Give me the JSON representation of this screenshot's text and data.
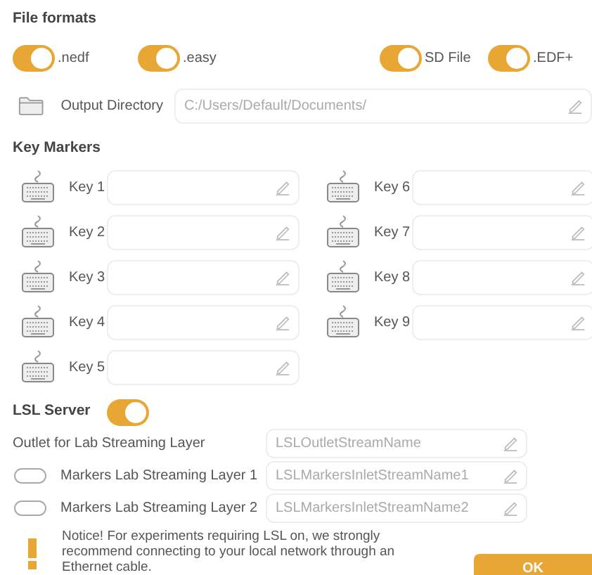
{
  "file_formats": {
    "title": "File formats",
    "toggles": [
      {
        "label": ".nedf",
        "on": true
      },
      {
        "label": ".easy",
        "on": true
      },
      {
        "label": "SD File",
        "on": true
      },
      {
        "label": ".EDF+",
        "on": true
      }
    ]
  },
  "output_directory": {
    "label": "Output Directory",
    "placeholder": "C:/Users/Default/Documents/"
  },
  "key_markers": {
    "title": "Key Markers",
    "keys": [
      {
        "label": "Key 1"
      },
      {
        "label": "Key 2"
      },
      {
        "label": "Key 3"
      },
      {
        "label": "Key 4"
      },
      {
        "label": "Key 5"
      },
      {
        "label": "Key 6"
      },
      {
        "label": "Key 7"
      },
      {
        "label": "Key 8"
      },
      {
        "label": "Key 9"
      }
    ]
  },
  "lsl_server": {
    "title": "LSL Server",
    "on": true,
    "streams": [
      {
        "kind": "plain",
        "label": "Outlet for Lab Streaming Layer",
        "placeholder": "LSLOutletStreamName"
      },
      {
        "kind": "toggle",
        "on": false,
        "label": "Markers Lab Streaming Layer 1",
        "placeholder": "LSLMarkersInletStreamName1"
      },
      {
        "kind": "toggle",
        "on": false,
        "label": "Markers Lab Streaming Layer 2",
        "placeholder": "LSLMarkersInletStreamName2"
      }
    ]
  },
  "notice": "Notice! For experiments requiring LSL on, we strongly recommend connecting to your local network through an Ethernet cable.",
  "ok_button": "OK"
}
